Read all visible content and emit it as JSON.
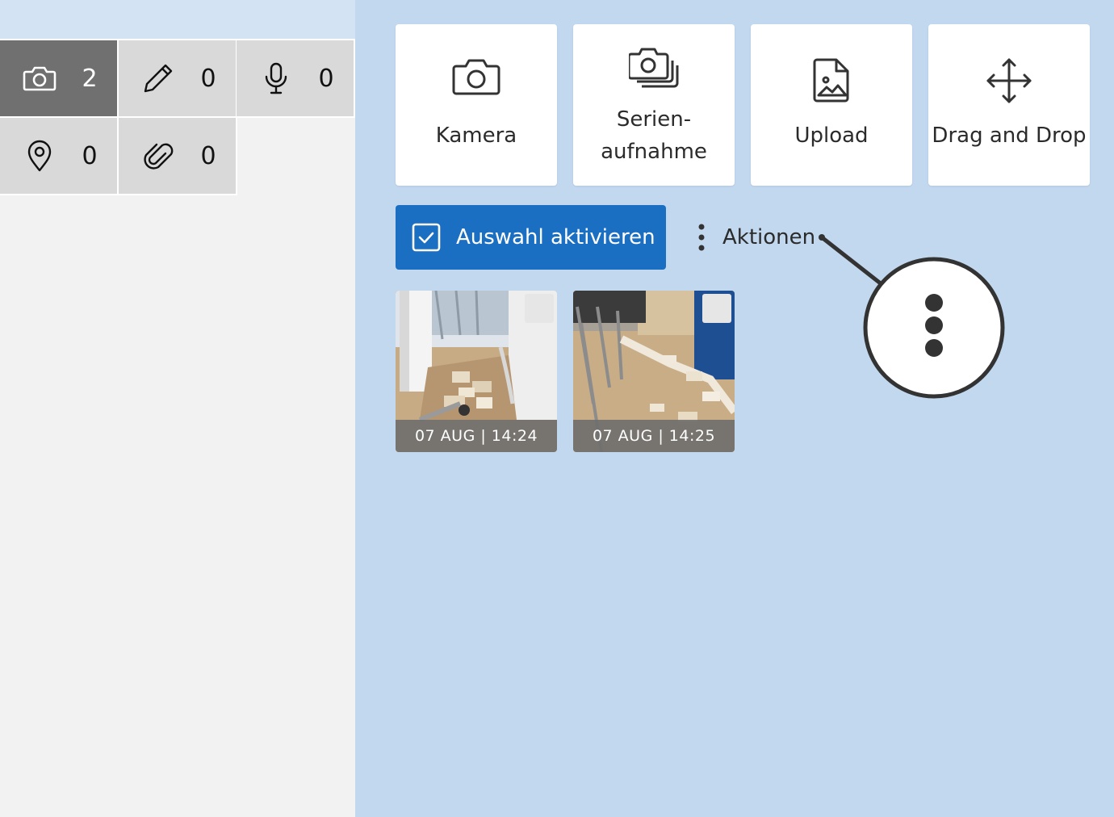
{
  "sidebar": {
    "counters": [
      {
        "icon": "camera-icon",
        "value": "2",
        "active": true
      },
      {
        "icon": "pencil-icon",
        "value": "0",
        "active": false
      },
      {
        "icon": "microphone-icon",
        "value": "0",
        "active": false
      },
      {
        "icon": "location-pin-icon",
        "value": "0",
        "active": false
      },
      {
        "icon": "paperclip-icon",
        "value": "0",
        "active": false
      }
    ]
  },
  "capture_options": [
    {
      "label": "Kamera",
      "icon": "camera-icon"
    },
    {
      "label_line1": "Serien-",
      "label_line2": "aufnahme",
      "icon": "burst-camera-icon"
    },
    {
      "label": "Upload",
      "icon": "image-file-icon"
    },
    {
      "label": "Drag and Drop",
      "icon": "move-arrows-icon"
    }
  ],
  "toolbar": {
    "select_label": "Auswahl aktivieren",
    "actions_label": "Aktionen"
  },
  "photos": [
    {
      "caption": "07 AUG | 14:24"
    },
    {
      "caption": "07 AUG | 14:25"
    }
  ],
  "colors": {
    "primary": "#1b6fc2",
    "panel_bg": "#c2d8ef",
    "active_counter": "#707070"
  }
}
